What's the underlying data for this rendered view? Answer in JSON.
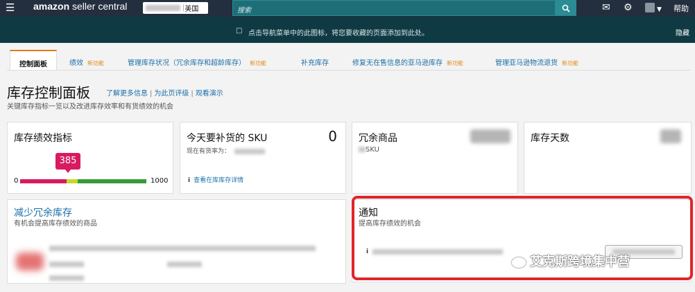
{
  "topbar": {
    "logo_main": "amazon",
    "logo_rest": " seller central",
    "marketplace": "美国",
    "search_placeholder": "搜索",
    "help": "帮助"
  },
  "bookmark_bar": {
    "message": "点击导航菜单中的此图标，将您要收藏的页面添加到此处。",
    "hide": "隐藏"
  },
  "tabs": [
    {
      "label": "控制面板",
      "badge": ""
    },
    {
      "label": "绩效",
      "badge": "新功能"
    },
    {
      "label": "管理库存状况（冗余库存和超龄库存）",
      "badge": "新功能"
    },
    {
      "label": "补充库存",
      "badge": ""
    },
    {
      "label": "修复无在售信息的亚马逊库存",
      "badge": "新功能"
    },
    {
      "label": "管理亚马逊物流退货",
      "badge": "新功能"
    }
  ],
  "page": {
    "title": "库存控制面板",
    "links": [
      "了解更多信息",
      "为此页评级",
      "观看演示"
    ],
    "subtitle": "关键库存指标一览以及改进库存效率和有货绩效的机会"
  },
  "cards": {
    "ipi": {
      "title": "库存绩效指标",
      "score": "385",
      "min": "0",
      "max": "1000",
      "score_value": 385,
      "scale_max": 1000
    },
    "restock": {
      "title": "今天要补货的 SKU",
      "count": "0",
      "stock_rate_label": "现在有货率为：",
      "link": "查看在库库存详情"
    },
    "excess": {
      "title": "冗余商品",
      "unit": "SKU"
    },
    "days": {
      "title": "库存天数"
    },
    "reduce": {
      "title": "减少冗余库存",
      "subtitle": "有机会提高库存绩效的商品"
    },
    "notice": {
      "title": "通知",
      "subtitle": "提高库存绩效的机会"
    }
  },
  "watermark": "艾克斯跨境集中营",
  "colors": {
    "topbar": "#232f3e",
    "bookmark_bar": "#0f3a44",
    "link": "#1c6fa8",
    "active_tab_accent": "#e47911",
    "gauge_red": "#d81b60",
    "gauge_yellow": "#c8d82a",
    "gauge_green": "#3a9a3a",
    "highlight": "#e1262a"
  }
}
